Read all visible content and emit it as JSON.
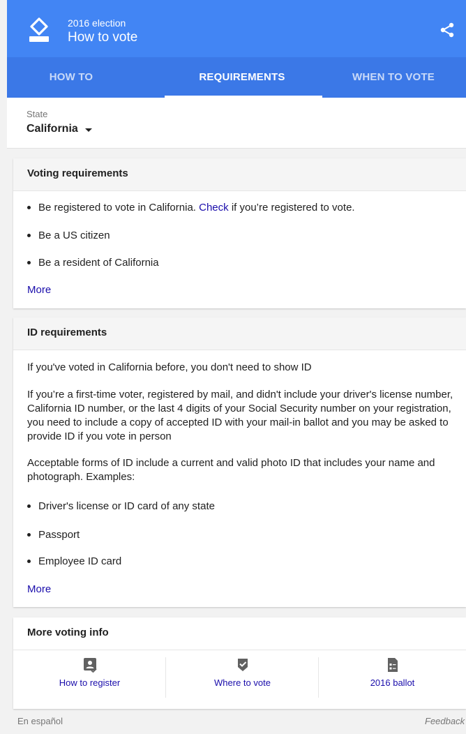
{
  "header": {
    "subtitle": "2016 election",
    "title": "How to vote",
    "logo_icon": "ballot-box-icon",
    "share_icon": "share-icon"
  },
  "tabs": [
    {
      "label": "HOW TO",
      "active": false
    },
    {
      "label": "REQUIREMENTS",
      "active": true
    },
    {
      "label": "WHEN TO VOTE",
      "active": false
    }
  ],
  "state": {
    "label": "State",
    "value": "California"
  },
  "voting_requirements": {
    "heading": "Voting requirements",
    "bullet1_before": "Be registered to vote in California. ",
    "bullet1_link": "Check",
    "bullet1_after": " if you’re registered to vote.",
    "bullet2": "Be a US citizen",
    "bullet3": "Be a resident of California",
    "more": "More"
  },
  "id_requirements": {
    "heading": "ID requirements",
    "para1": "If you've voted in California before, you don't need to show ID",
    "para2": "If you’re a first-time voter, registered by mail, and didn't include your driver's license number, California ID number, or the last 4 digits of your Social Security number on your registration, you need to include a copy of accepted ID with your mail-in ballot and you may be asked to provide ID if you vote in person",
    "para3": "Acceptable forms of ID include a current and valid photo ID that includes your name and photograph. Examples:",
    "bullets": [
      "Driver's license or ID card of any state",
      "Passport",
      "Employee ID card"
    ],
    "more": "More"
  },
  "more_info": {
    "heading": "More voting info",
    "items": [
      {
        "label": "How to register",
        "icon": "register-icon"
      },
      {
        "label": "Where to vote",
        "icon": "location-check-icon"
      },
      {
        "label": "2016 ballot",
        "icon": "ballot-icon"
      }
    ]
  },
  "footer": {
    "language": "En español",
    "feedback": "Feedback"
  },
  "colors": {
    "header_blue": "#4285f4",
    "tab_blue": "#3b78e7",
    "link": "#1a0dab"
  }
}
